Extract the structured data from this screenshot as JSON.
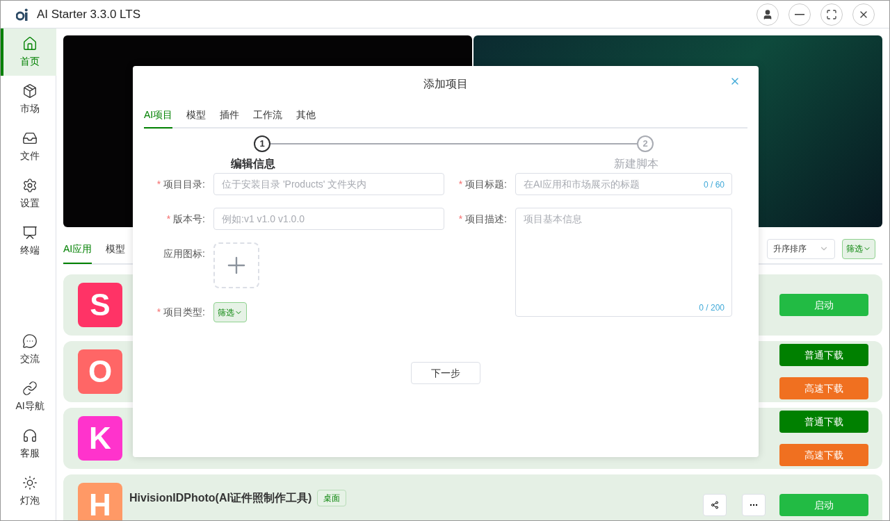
{
  "window": {
    "title": "AI Starter 3.3.0 LTS"
  },
  "sidebar": {
    "top": [
      {
        "label": "首页",
        "selected": true
      },
      {
        "label": "市场",
        "selected": false
      },
      {
        "label": "文件",
        "selected": false
      },
      {
        "label": "设置",
        "selected": false
      },
      {
        "label": "终端",
        "selected": false
      }
    ],
    "bottom": [
      {
        "label": "交流",
        "selected": false
      },
      {
        "label": "AI导航",
        "selected": false
      },
      {
        "label": "客服",
        "selected": false
      },
      {
        "label": "灯泡",
        "selected": false
      }
    ]
  },
  "content_tabs": [
    {
      "label": "AI应用",
      "selected": true
    },
    {
      "label": "模型",
      "selected": false
    }
  ],
  "sort_select": {
    "value": "升序排序"
  },
  "filter_button": {
    "label": "筛选"
  },
  "apps": [
    {
      "letter": "S",
      "color": "#ff3366",
      "buttons": [
        {
          "label": "启动",
          "kind": "launch"
        }
      ]
    },
    {
      "letter": "O",
      "color": "#ff6666",
      "buttons": [
        {
          "label": "普通下载",
          "kind": "download"
        },
        {
          "label": "高速下载",
          "kind": "fast"
        }
      ]
    },
    {
      "letter": "K",
      "color": "#ff33cc",
      "buttons": [
        {
          "label": "普通下载",
          "kind": "download"
        },
        {
          "label": "高速下载",
          "kind": "fast"
        }
      ]
    },
    {
      "letter": "H",
      "color": "#ff9966",
      "title": "HivisionIDPhoto(AI证件照制作工具)",
      "tag": "桌面",
      "buttons": [
        {
          "label": "启动",
          "kind": "launch"
        }
      ]
    }
  ],
  "modal": {
    "title": "添加项目",
    "tabs": [
      {
        "label": "AI项目",
        "selected": true
      },
      {
        "label": "模型",
        "selected": false
      },
      {
        "label": "插件",
        "selected": false
      },
      {
        "label": "工作流",
        "selected": false
      },
      {
        "label": "其他",
        "selected": false
      }
    ],
    "steps": [
      {
        "number": "1",
        "label": "编辑信息",
        "active": true
      },
      {
        "number": "2",
        "label": "新建脚本",
        "active": false
      }
    ],
    "left_fields": [
      {
        "required_mark": "*",
        "label": "项目目录:",
        "kind": "input",
        "placeholder": "位于安装目录 'Products' 文件夹内"
      },
      {
        "required_mark": "*",
        "label": "版本号:",
        "kind": "input",
        "placeholder": "例如:v1 v1.0 v1.0.0"
      },
      {
        "label": "应用图标:",
        "kind": "upload"
      },
      {
        "required_mark": "*",
        "label": "项目类型:",
        "kind": "filter",
        "value": "筛选"
      }
    ],
    "right_fields": [
      {
        "required_mark": "*",
        "label": "项目标题:",
        "kind": "input",
        "placeholder": "在AI应用和市场展示的标题",
        "counter": "0 / 60"
      },
      {
        "required_mark": "*",
        "label": "项目描述:",
        "kind": "textarea",
        "placeholder": "项目基本信息",
        "counter": "0 / 200"
      }
    ],
    "next_button": "下一步"
  }
}
